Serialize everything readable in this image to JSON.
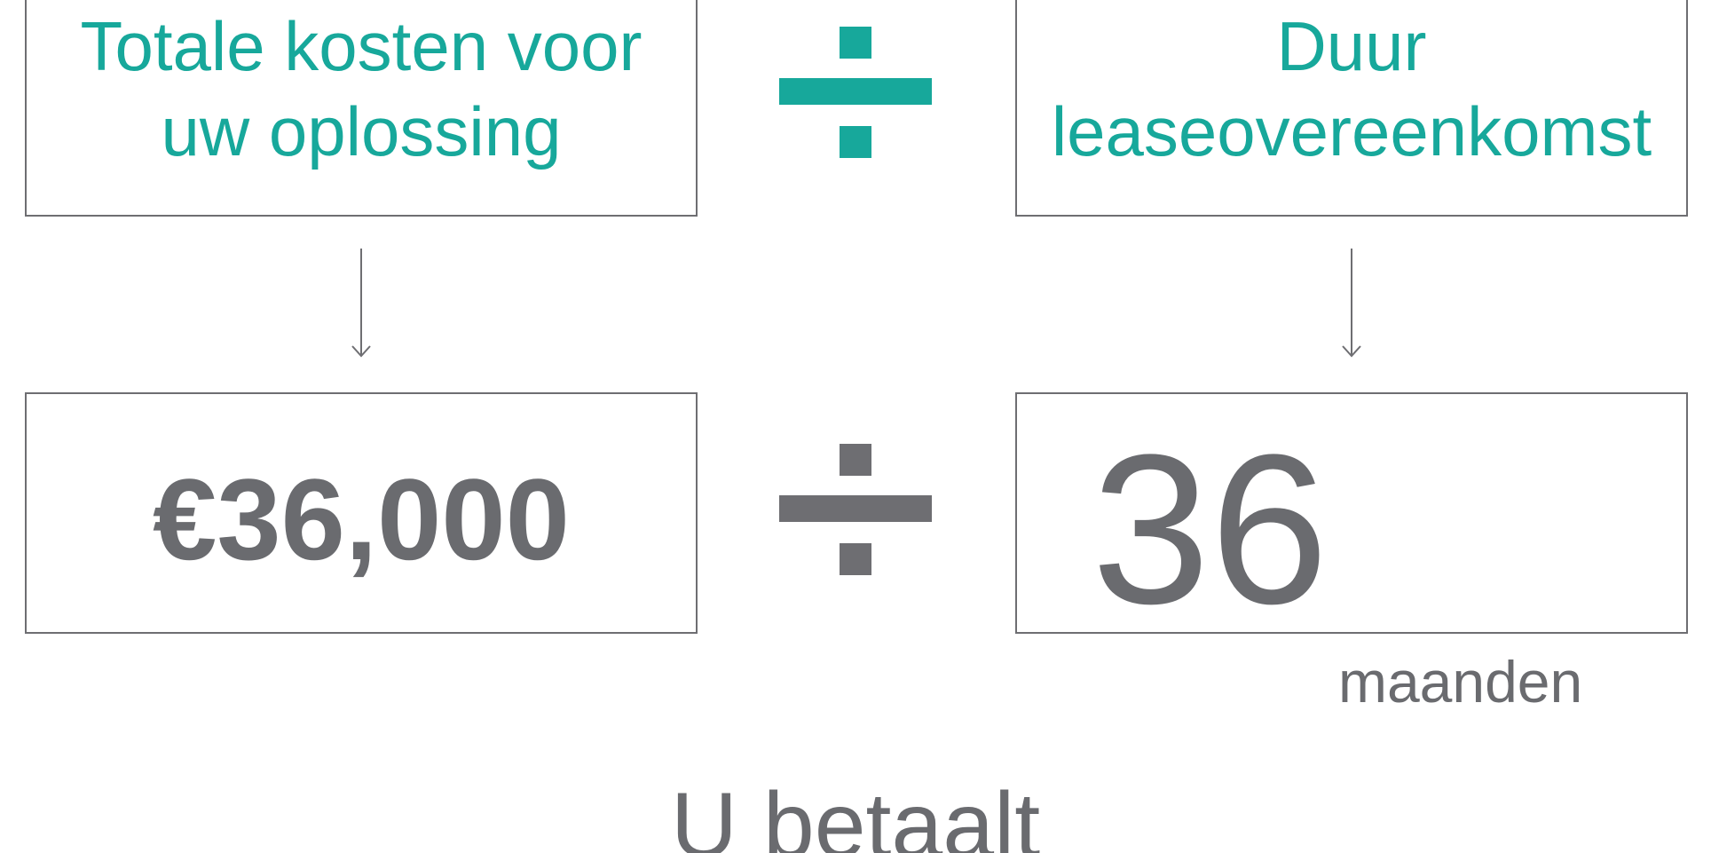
{
  "top": {
    "left_label_line1": "Totale kosten voor",
    "left_label_line2": "uw oplossing",
    "right_label_line1": "Duur",
    "right_label_line2": "leaseovereenkomst"
  },
  "bottom": {
    "amount": "€36,000",
    "months_value": "36",
    "months_unit": "maanden"
  },
  "footer": {
    "pay_label": "U betaalt"
  },
  "colors": {
    "accent": "#17a89b",
    "gray": "#6e6e72",
    "text_gray": "#6a6b6f"
  },
  "icons": {
    "operator": "division-sign-icon",
    "arrow": "arrow-down-icon"
  }
}
